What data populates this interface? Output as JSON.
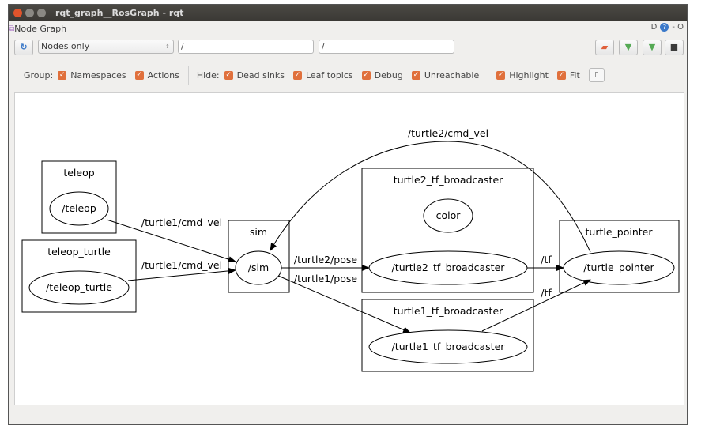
{
  "window": {
    "title": "rqt_graph__RosGraph - rqt"
  },
  "plugin": {
    "title": "Node Graph",
    "right_labels": [
      "D",
      "?",
      "- O"
    ]
  },
  "toolbar": {
    "mode": "Nodes only",
    "filter1": "/",
    "filter2": "/"
  },
  "options": {
    "group_label": "Group:",
    "group": [
      {
        "label": "Namespaces",
        "checked": true
      },
      {
        "label": "Actions",
        "checked": true
      }
    ],
    "hide_label": "Hide:",
    "hide": [
      {
        "label": "Dead sinks",
        "checked": true
      },
      {
        "label": "Leaf topics",
        "checked": true
      },
      {
        "label": "Debug",
        "checked": true
      },
      {
        "label": "Unreachable",
        "checked": true
      }
    ],
    "view": [
      {
        "label": "Highlight",
        "checked": true
      },
      {
        "label": "Fit",
        "checked": true
      }
    ]
  },
  "colors": {
    "checkbox": "#e0703c",
    "titlebar": "#3b3935"
  },
  "graph": {
    "clusters": {
      "teleop": "teleop",
      "teleop_turtle": "teleop_turtle",
      "sim": "sim",
      "turtle2_tf": "turtle2_tf_broadcaster",
      "turtle1_tf": "turtle1_tf_broadcaster",
      "pointer": "turtle_pointer"
    },
    "nodes": {
      "teleop": "/teleop",
      "teleop_turtle": "/teleop_turtle",
      "sim": "/sim",
      "color": "color",
      "turtle2_tf": "/turtle2_tf_broadcaster",
      "turtle1_tf": "/turtle1_tf_broadcaster",
      "pointer": "/turtle_pointer"
    },
    "edges": {
      "e1": "/turtle1/cmd_vel",
      "e2": "/turtle1/cmd_vel",
      "e3": "/turtle2/pose",
      "e4": "/turtle1/pose",
      "e5": "/tf",
      "e6": "/tf",
      "e7": "/turtle2/cmd_vel"
    }
  }
}
